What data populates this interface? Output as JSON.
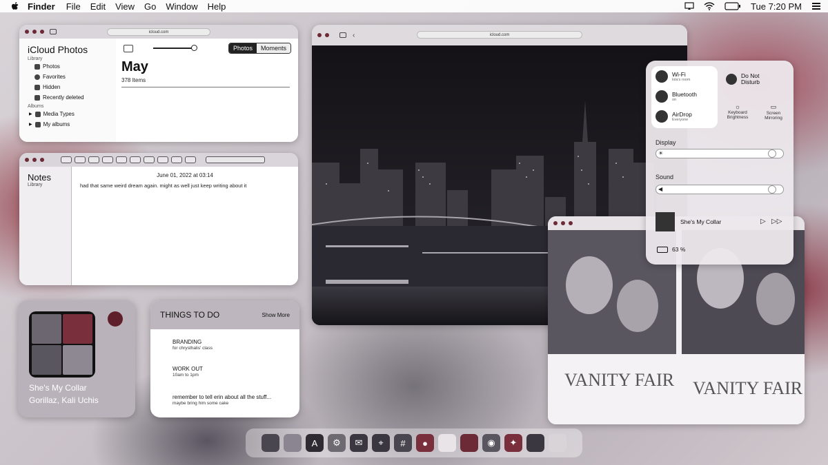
{
  "menubar": {
    "app": "Finder",
    "items": [
      "File",
      "Edit",
      "View",
      "Go",
      "Window",
      "Help"
    ],
    "clock": "Tue 7:20 PM",
    "icons": [
      "apple-icon",
      "screen-mirroring-icon",
      "wifi-icon",
      "battery-icon",
      "control-center-icon"
    ]
  },
  "photos": {
    "url": "icloud.com",
    "title": "iCloud Photos",
    "library_heading": "Library",
    "library_items": [
      "Photos",
      "Favorites",
      "Hidden",
      "Recently deleted"
    ],
    "albums_heading": "Albums",
    "album_items": [
      "Media Types",
      "My albums"
    ],
    "seg_photos": "Photos",
    "seg_moments": "Moments",
    "month": "May",
    "count": "378 Items"
  },
  "notes": {
    "title": "Notes",
    "sidebar_sub": "Library",
    "date": "June 01, 2022 at 03:14",
    "text": "had that same weird dream again. might as well just keep writing about it"
  },
  "city": {
    "url": "icloud.com"
  },
  "control_center": {
    "wifi_label": "Wi-Fi",
    "wifi_sub": "lola's room",
    "bluetooth_label": "Bluetooth",
    "bluetooth_sub": "on",
    "airdrop_label": "AirDrop",
    "airdrop_sub": "Everyone",
    "dnd_label": "Do Not Disturb",
    "kb_label": "Keyboard Brightness",
    "mirror_label": "Screen Mirroring",
    "display_label": "Display",
    "display_level": 0.95,
    "sound_label": "Sound",
    "sound_level": 0.95,
    "now_playing": "She's My Collar",
    "battery": "63 %"
  },
  "music_widget": {
    "song": "She's My Collar",
    "artist": "Gorillaz, Kali Uchis"
  },
  "todo": {
    "title": "THINGS TO DO",
    "more": "Show More",
    "tasks": [
      {
        "title": "BRANDING",
        "sub": "for chrysthalis' class"
      },
      {
        "title": "WORK OUT",
        "sub": "10am to 1pm"
      },
      {
        "title": "remember to tell erin about all the stuff...",
        "sub": "maybe bring him some cake"
      }
    ]
  },
  "vanity": {
    "text": "VANITY FAIR"
  },
  "dock": {
    "apps": [
      "finder-icon",
      "launchpad-icon",
      "app-store-icon",
      "system-preferences-icon",
      "mail-icon",
      "safari-icon",
      "slack-icon",
      "messages-icon",
      "notes-icon",
      "photos-icon",
      "chrome-icon",
      "custom-app-icon",
      "folder-icon",
      "trash-icon"
    ]
  },
  "colors": {
    "accent": "#6b2a35",
    "panel": "#bdb6be"
  }
}
